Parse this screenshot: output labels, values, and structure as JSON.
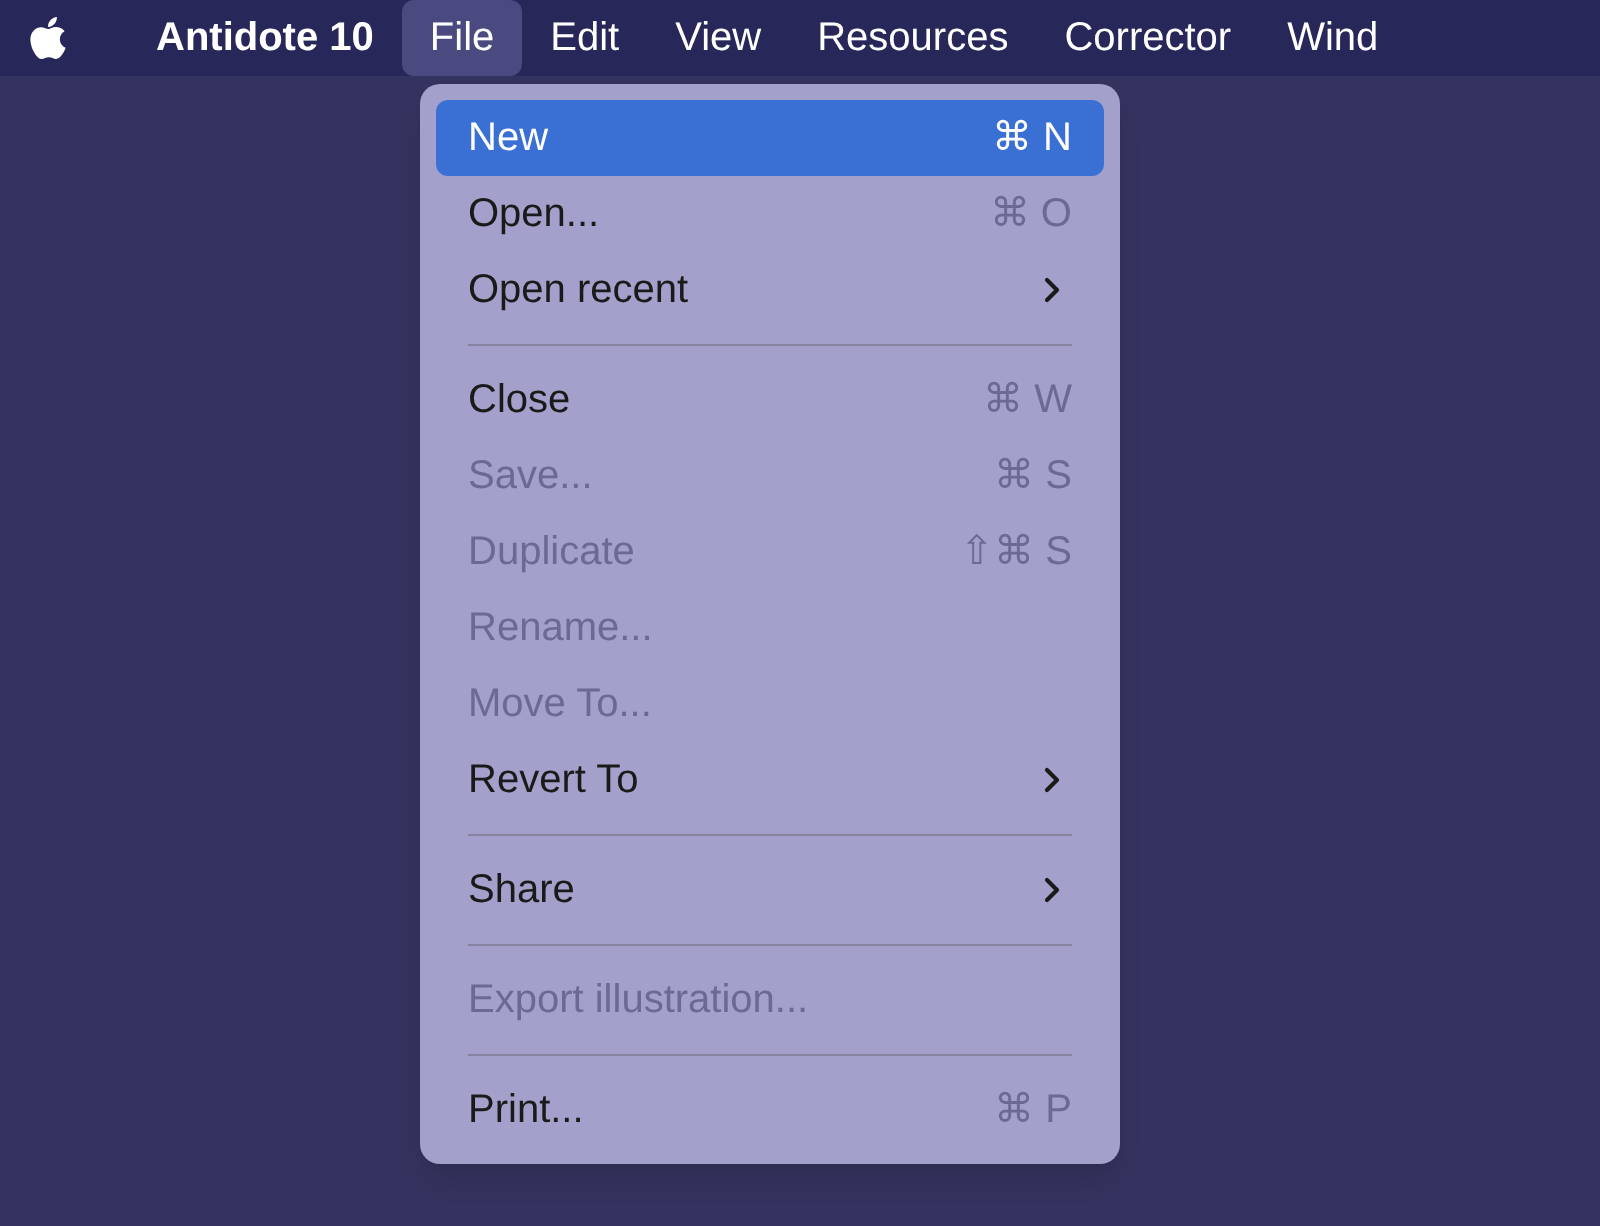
{
  "menu_bar": [
    {
      "label": "Antidote 10",
      "kind": "app",
      "selected": false
    },
    {
      "label": "File",
      "kind": "menu",
      "selected": true
    },
    {
      "label": "Edit",
      "kind": "menu",
      "selected": false
    },
    {
      "label": "View",
      "kind": "menu",
      "selected": false
    },
    {
      "label": "Resources",
      "kind": "menu",
      "selected": false
    },
    {
      "label": "Corrector",
      "kind": "menu",
      "selected": false
    },
    {
      "label": "Wind",
      "kind": "menu",
      "selected": false
    }
  ],
  "file_menu": [
    {
      "kind": "item",
      "label": "New",
      "shortcut": "⌘ N",
      "selected": true,
      "disabled": false,
      "submenu": false
    },
    {
      "kind": "item",
      "label": "Open...",
      "shortcut": "⌘ O",
      "selected": false,
      "disabled": false,
      "submenu": false
    },
    {
      "kind": "item",
      "label": "Open recent",
      "selected": false,
      "disabled": false,
      "submenu": true
    },
    {
      "kind": "separator"
    },
    {
      "kind": "item",
      "label": "Close",
      "shortcut": "⌘ W",
      "selected": false,
      "disabled": false,
      "submenu": false
    },
    {
      "kind": "item",
      "label": "Save...",
      "shortcut": "⌘ S",
      "selected": false,
      "disabled": true,
      "submenu": false
    },
    {
      "kind": "item",
      "label": "Duplicate",
      "shortcut": "⇧⌘ S",
      "selected": false,
      "disabled": true,
      "submenu": false
    },
    {
      "kind": "item",
      "label": "Rename...",
      "selected": false,
      "disabled": true,
      "submenu": false
    },
    {
      "kind": "item",
      "label": "Move To...",
      "selected": false,
      "disabled": true,
      "submenu": false
    },
    {
      "kind": "item",
      "label": "Revert To",
      "selected": false,
      "disabled": false,
      "submenu": true
    },
    {
      "kind": "separator"
    },
    {
      "kind": "item",
      "label": "Share",
      "selected": false,
      "disabled": false,
      "submenu": true
    },
    {
      "kind": "separator"
    },
    {
      "kind": "item",
      "label": "Export illustration...",
      "selected": false,
      "disabled": true,
      "submenu": false
    },
    {
      "kind": "separator"
    },
    {
      "kind": "item",
      "label": "Print...",
      "shortcut": "⌘ P",
      "selected": false,
      "disabled": false,
      "submenu": false
    }
  ]
}
